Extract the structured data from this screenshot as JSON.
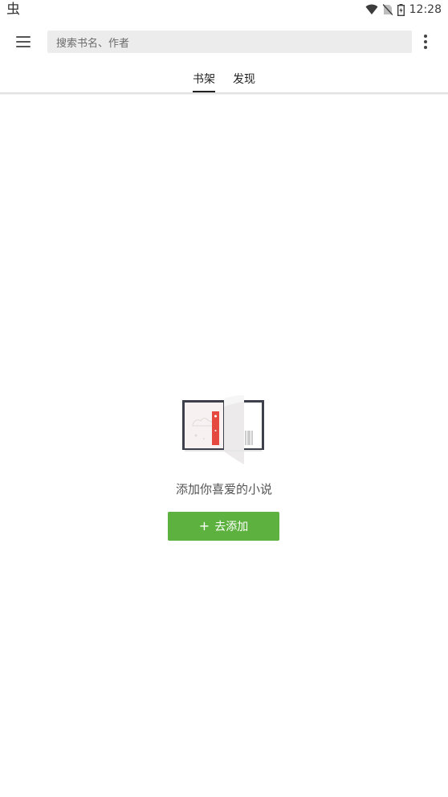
{
  "status_bar": {
    "app_glyph": "虫",
    "time": "12:28",
    "icons": [
      "wifi-icon",
      "no-sim-icon",
      "battery-icon"
    ]
  },
  "toolbar": {
    "menu_icon": "hamburger-menu-icon",
    "search_placeholder": "搜索书名、作者",
    "more_icon": "more-vert-icon"
  },
  "tabs": [
    {
      "label": "书架",
      "active": true
    },
    {
      "label": "发现",
      "active": false
    }
  ],
  "empty_state": {
    "illustration": "open-book-icon",
    "message": "添加你喜爱的小说",
    "button_icon": "+",
    "button_label": "去添加"
  },
  "colors": {
    "accent_green": "#5db23f",
    "bookmark_red": "#e5483f",
    "search_bg": "#ececec"
  }
}
